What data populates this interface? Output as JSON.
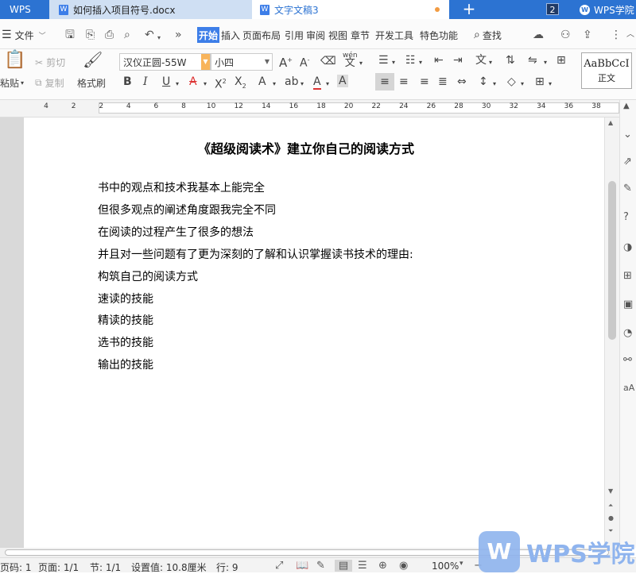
{
  "tabs": {
    "app": "WPS",
    "doc1": "如何插入项目符号.docx",
    "doc2": "文字文稿3",
    "window_count": "2",
    "academy": "WPS学院"
  },
  "menu": {
    "file": "文件",
    "items": [
      "开始",
      "插入",
      "页面布局",
      "引用",
      "审阅",
      "视图",
      "章节",
      "开发工具",
      "特色功能"
    ],
    "search": "查找"
  },
  "ribbon": {
    "paste": "粘贴",
    "cut": "剪切",
    "copy": "复制",
    "format_painter": "格式刷",
    "font_name": "汉仪正圆-55W",
    "font_size": "小四",
    "style_sample": "AaBbCcI",
    "style_name": "正文",
    "pinyin_glyph": "wén"
  },
  "ruler": [
    "4",
    "2",
    "2",
    "4",
    "6",
    "8",
    "10",
    "12",
    "14",
    "16",
    "18",
    "20",
    "22",
    "24",
    "26",
    "28",
    "30",
    "32",
    "34",
    "36",
    "38"
  ],
  "document": {
    "title": "《超级阅读术》建立你自己的阅读方式",
    "lines": [
      "书中的观点和技术我基本上能完全",
      "但很多观点的阐述角度跟我完全不同",
      "在阅读的过程产生了很多的想法",
      "并且对一些问题有了更为深刻的了解和认识掌握读书技术的理由:",
      "构筑自己的阅读方式",
      "速读的技能",
      "精读的技能",
      "选书的技能",
      "输出的技能"
    ]
  },
  "status": {
    "page_code": "页码: 1",
    "pages": "页面: 1/1",
    "section": "节: 1/1",
    "setting": "设置值: 10.8厘米",
    "row": "行: 9",
    "zoom": "100%"
  },
  "watermark": "WPS学院",
  "colors": {
    "accent": "#2c73d2",
    "tab_active": "#3d7ee8",
    "modified_dot": "#f29b42"
  }
}
